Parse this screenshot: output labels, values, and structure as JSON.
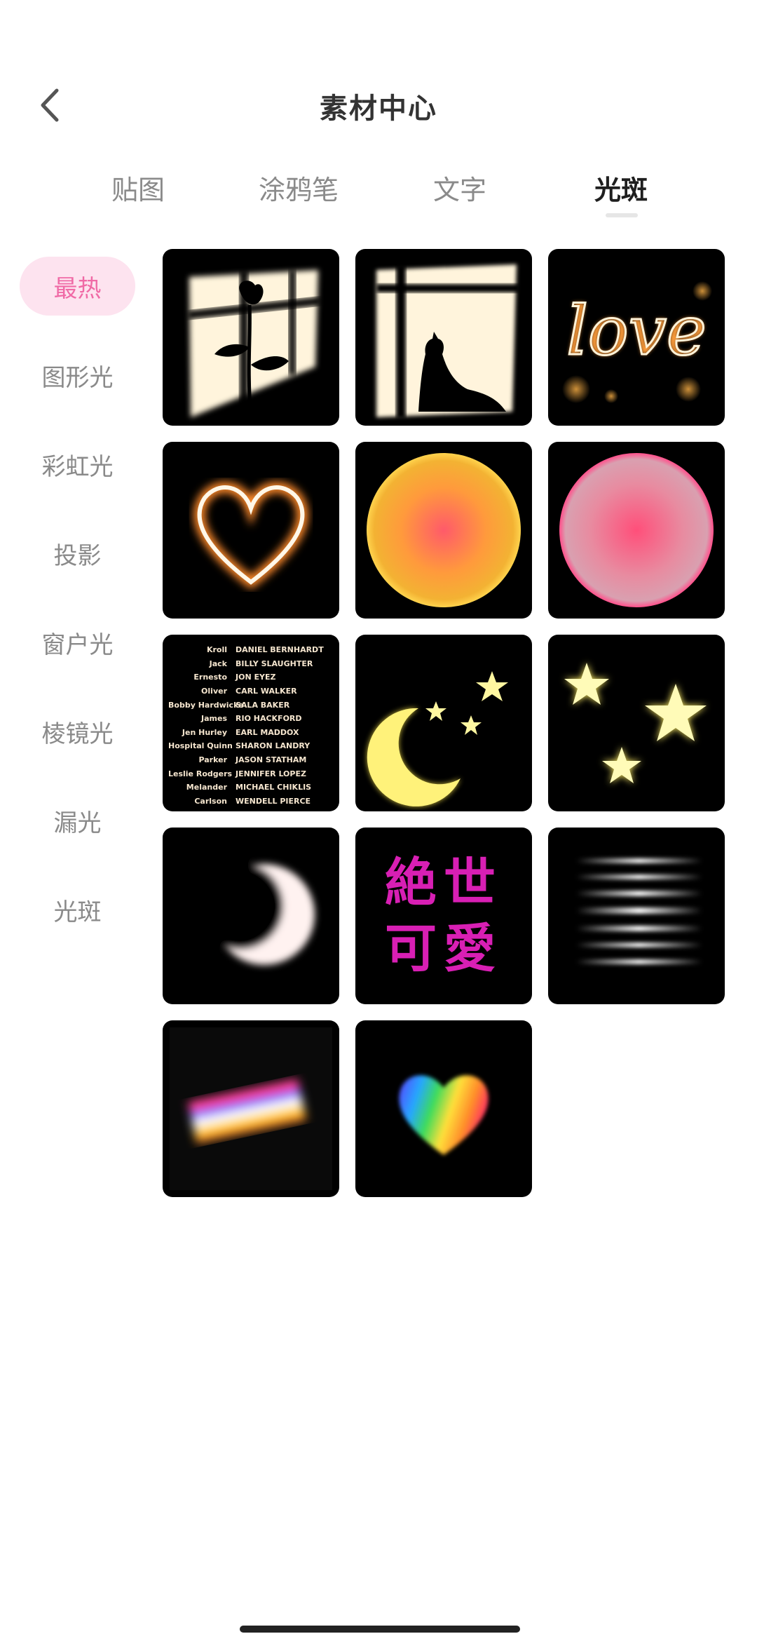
{
  "header": {
    "title": "素材中心",
    "back_icon": "chevron-left-icon"
  },
  "tabs": [
    {
      "label": "贴图",
      "active": false
    },
    {
      "label": "涂鸦笔",
      "active": false
    },
    {
      "label": "文字",
      "active": false
    },
    {
      "label": "光斑",
      "active": true
    }
  ],
  "sidebar": {
    "items": [
      {
        "label": "最热",
        "active": true
      },
      {
        "label": "图形光",
        "active": false
      },
      {
        "label": "彩虹光",
        "active": false
      },
      {
        "label": "投影",
        "active": false
      },
      {
        "label": "窗户光",
        "active": false
      },
      {
        "label": "棱镜光",
        "active": false
      },
      {
        "label": "漏光",
        "active": false
      },
      {
        "label": "光斑",
        "active": false
      }
    ]
  },
  "grid": {
    "tiles": [
      {
        "icon": "window-rose-shadow"
      },
      {
        "icon": "window-cat-shadow"
      },
      {
        "icon": "love-sparkler",
        "text": "love"
      },
      {
        "icon": "glowing-heart-outline"
      },
      {
        "icon": "orange-gradient-circle"
      },
      {
        "icon": "pink-gradient-circle"
      },
      {
        "icon": "movie-credits"
      },
      {
        "icon": "moon-and-stars"
      },
      {
        "icon": "three-stars"
      },
      {
        "icon": "crescent-moon"
      },
      {
        "icon": "cjk-text"
      },
      {
        "icon": "horizontal-light-streaks"
      },
      {
        "icon": "rainbow-streak"
      },
      {
        "icon": "rainbow-heart"
      }
    ],
    "credits": [
      [
        "Kroll",
        "DANIEL BERNHARDT"
      ],
      [
        "Jack",
        "BILLY SLAUGHTER"
      ],
      [
        "Ernesto",
        "JON EYEZ"
      ],
      [
        "Oliver",
        "CARL WALKER"
      ],
      [
        "Bobby Hardwicke",
        "SALA BAKER"
      ],
      [
        "James",
        "RIO HACKFORD"
      ],
      [
        "Jen Hurley",
        "EARL MADDOX"
      ],
      [
        "Hospital Quinn",
        "SHARON LANDRY"
      ],
      [
        "Parker",
        "JASON STATHAM"
      ],
      [
        "Leslie Rodgers",
        "JENNIFER LOPEZ"
      ],
      [
        "Melander",
        "MICHAEL CHIKLIS"
      ],
      [
        "Carlson",
        "WENDELL PIERCE"
      ]
    ],
    "cjk_lines": [
      "絶世",
      "可愛"
    ]
  },
  "colors": {
    "accent": "#f06aa6",
    "accent_bg": "#fde3ef",
    "tile_bg": "#000000"
  }
}
